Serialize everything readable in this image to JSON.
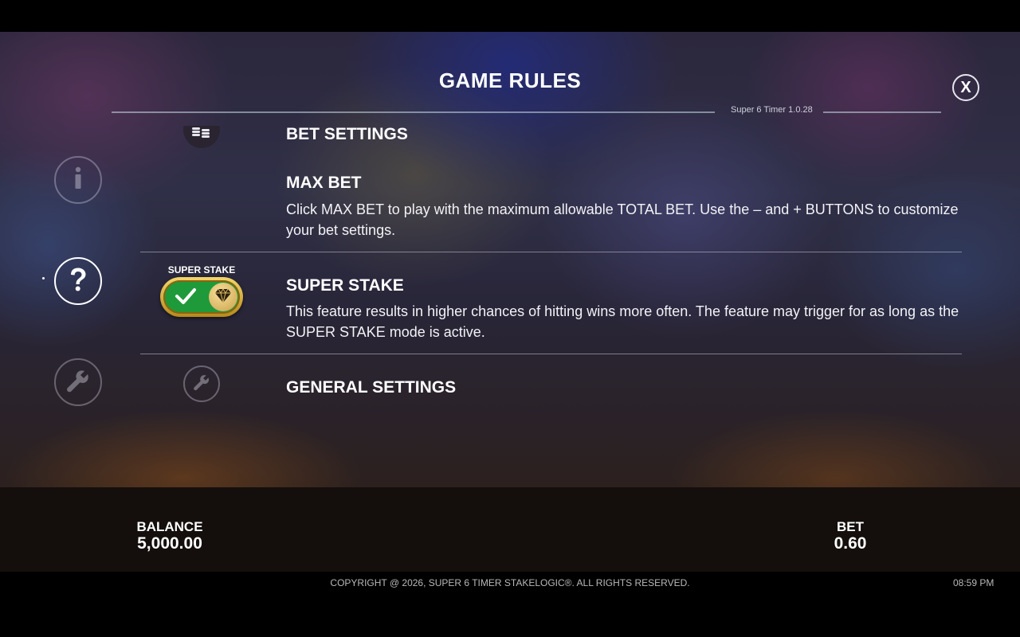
{
  "header": {
    "title": "GAME RULES",
    "version": "Super 6 Timer 1.0.28",
    "close_label": "X"
  },
  "sections": {
    "bet_settings": "BET SETTINGS",
    "max_bet": {
      "title": "MAX BET",
      "text": "Click MAX BET to play with the maximum allowable TOTAL BET. Use the – and + BUTTONS to customize your bet settings."
    },
    "super_stake": {
      "badge_label": "SUPER STAKE",
      "title": "SUPER STAKE",
      "text": "This feature results in higher chances of hitting wins more often. The feature may trigger for as long as the SUPER STAKE mode is active."
    },
    "general_settings": "GENERAL SETTINGS"
  },
  "nav": {
    "items": [
      {
        "icon": "info-icon",
        "active": false
      },
      {
        "icon": "question-icon",
        "active": true
      },
      {
        "icon": "wrench-icon",
        "active": false
      }
    ]
  },
  "status": {
    "balance_label": "BALANCE",
    "balance_value": "5,000.00",
    "bet_label": "BET",
    "bet_value": "0.60"
  },
  "footer": {
    "copyright": "COPYRIGHT @ 2026, SUPER 6 TIMER STAKELOGIC®. ALL RIGHTS RESERVED.",
    "time": "08:59 PM"
  },
  "colors": {
    "toggle_gold": "#d9b040",
    "toggle_green": "#1f9a3a"
  }
}
